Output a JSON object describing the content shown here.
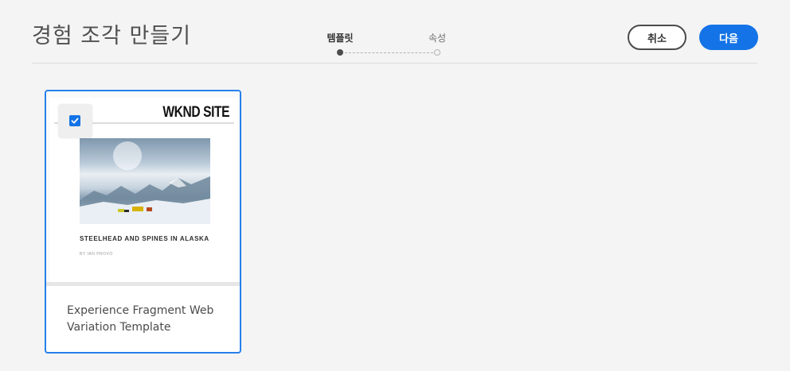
{
  "header": {
    "title": "경험 조각 만들기",
    "steps": [
      {
        "label": "템플릿",
        "state": "active"
      },
      {
        "label": "속성",
        "state": "upcoming"
      }
    ],
    "cancel_label": "취소",
    "next_label": "다음"
  },
  "templates": [
    {
      "name": "Experience Fragment Web Variation Template",
      "selected": true,
      "thumbnail": {
        "site_name": "WKND SITE",
        "article_title": "STEELHEAD AND SPINES IN ALASKA",
        "byline": "BY IAN PROVO",
        "image": "snowy mountain camp with tents"
      }
    }
  ],
  "colors": {
    "accent": "#1473e6",
    "selection_border": "#2680eb",
    "background": "#f4f4f4"
  },
  "icons": {
    "checkbox": "checkmark-icon"
  }
}
